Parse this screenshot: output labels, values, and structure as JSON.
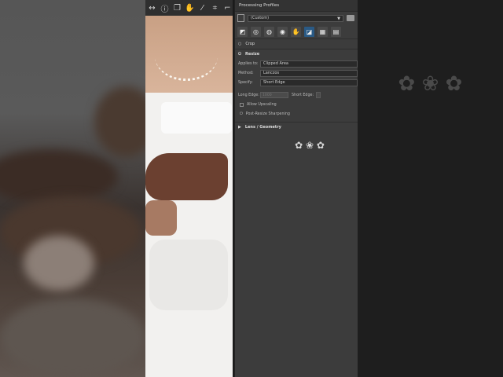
{
  "viewer_toolbar": {
    "icons": [
      "arrow-icon",
      "info-icon",
      "copy-icon",
      "hand-icon",
      "picker-icon",
      "crop-icon",
      "pen-icon"
    ],
    "glyphs": [
      "↔",
      "ⓘ",
      "❐",
      "✋",
      "⁄",
      "⌗",
      "⌐"
    ]
  },
  "panel": {
    "title": "Processing Profiles",
    "profile_value": "(Custom)",
    "tab_glyphs": [
      "◩",
      "◎",
      "◍",
      "◉",
      "✋",
      "◪",
      "▦",
      "▤"
    ],
    "crop_label": "Crop",
    "resize_label": "Resize",
    "applies_to_label": "Applies to:",
    "applies_to_value": "Clipped Area",
    "method_label": "Method:",
    "method_value": "Lanczos",
    "specify_label": "Specify:",
    "specify_value": "Short Edge",
    "long_edge_label": "Long Edge:",
    "long_edge_value": "1000",
    "short_edge_label": "Short Edge:",
    "allow_upscaling_label": "Allow Upscaling",
    "post_resize_label": "Post-Resize Sharpening",
    "lens_label": "Lens / Geometry"
  },
  "ornament": "✿ ❀ ✿"
}
